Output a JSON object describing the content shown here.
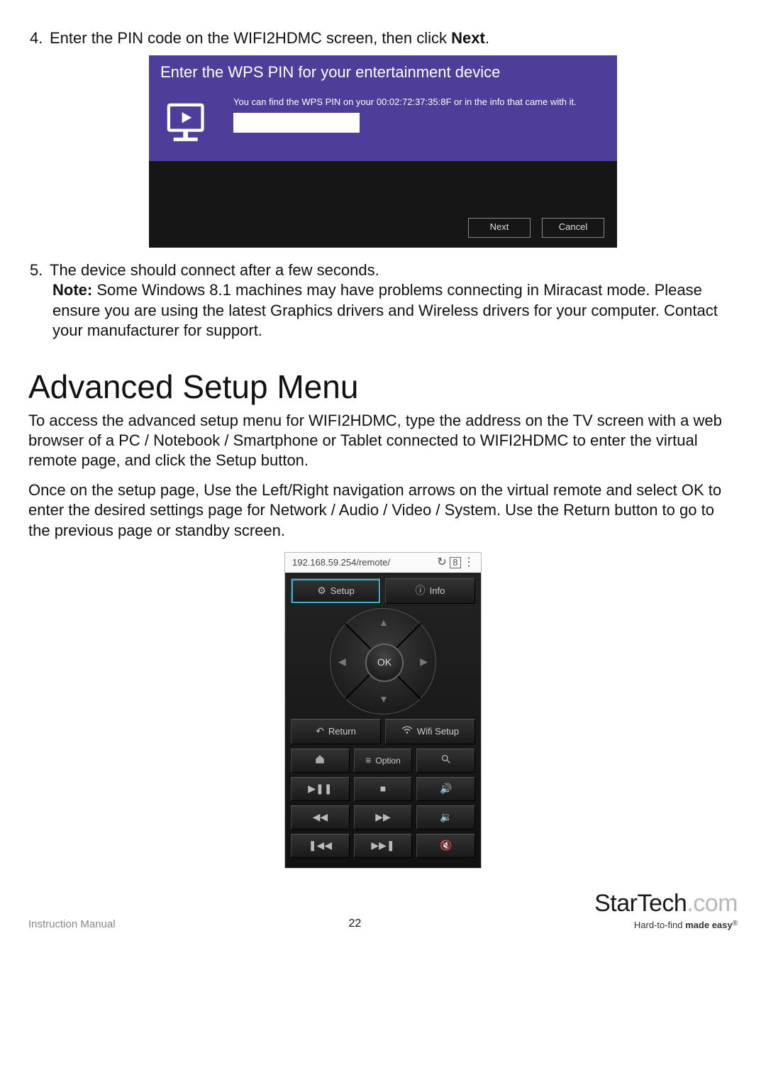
{
  "steps": {
    "four": {
      "num": "4.",
      "text_a": "Enter the PIN code on the WIFI2HDMC screen, then click ",
      "text_bold": "Next",
      "text_b": "."
    },
    "five": {
      "num": "5.",
      "line1": "The device should connect after a few seconds.",
      "note_label": "Note:",
      "note_body": " Some Windows 8.1 machines may have problems connecting in Miracast mode. Please ensure you are using the latest Graphics drivers and Wireless drivers for your computer. Contact your manufacturer for support."
    }
  },
  "wps": {
    "title": "Enter the WPS PIN for your entertainment device",
    "hint": "You can find the WPS PIN on your 00:02:72:37:35:8F or in the info that came with it.",
    "pin_value": "",
    "next": "Next",
    "cancel": "Cancel"
  },
  "heading": "Advanced Setup Menu",
  "para1": "To access the advanced setup menu for WIFI2HDMC, type the address on the TV screen with a web browser of a PC / Notebook / Smartphone or Tablet connected to WIFI2HDMC to enter the virtual remote page, and click the Setup button.",
  "para2": "Once on the setup page, Use the Left/Right navigation arrows on the virtual remote and select OK to enter the desired settings page for Network / Audio / Video / System. Use the Return button to go to the previous page or standby screen.",
  "remote": {
    "url": "192.168.59.254/remote/",
    "setup": "Setup",
    "info": "Info",
    "ok": "OK",
    "return": "Return",
    "wifi": "Wifi Setup",
    "option": "Option"
  },
  "footer": {
    "left": "Instruction Manual",
    "page": "22",
    "logo1": "StarTech",
    "logo2": ".com",
    "tag_a": "Hard-to-find ",
    "tag_b": "made easy",
    "tag_r": "®"
  }
}
